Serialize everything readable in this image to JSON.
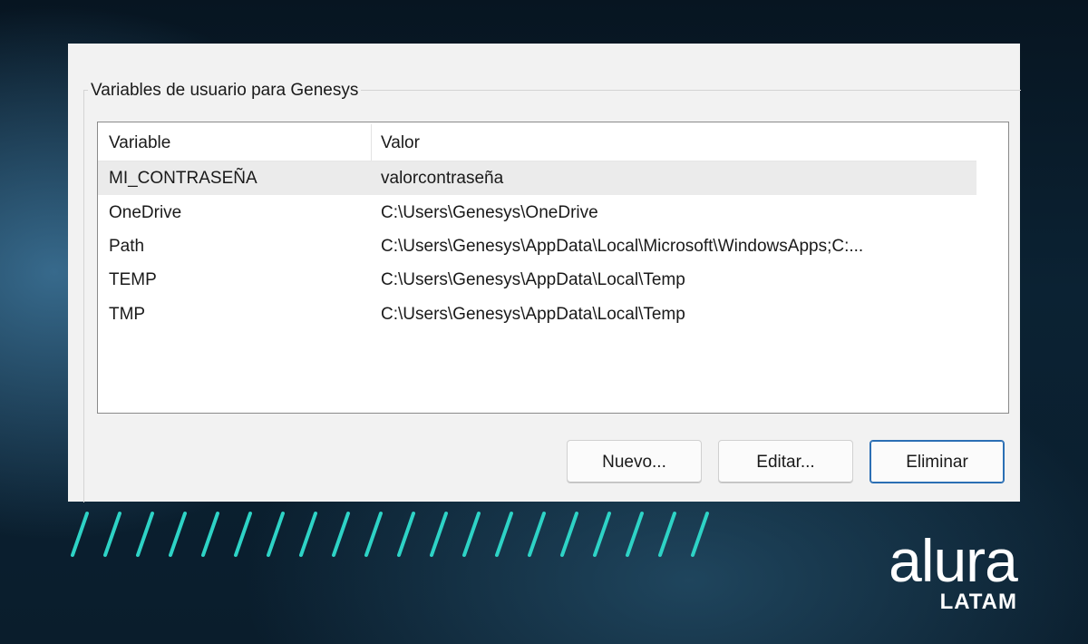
{
  "group": {
    "title": "Variables de usuario para Genesys"
  },
  "table": {
    "columns": [
      "Variable",
      "Valor"
    ],
    "rows": [
      {
        "variable": "MI_CONTRASEÑA",
        "value": "valorcontraseña",
        "selected": true
      },
      {
        "variable": "OneDrive",
        "value": "C:\\Users\\Genesys\\OneDrive"
      },
      {
        "variable": "Path",
        "value": "C:\\Users\\Genesys\\AppData\\Local\\Microsoft\\WindowsApps;C:..."
      },
      {
        "variable": "TEMP",
        "value": "C:\\Users\\Genesys\\AppData\\Local\\Temp"
      },
      {
        "variable": "TMP",
        "value": "C:\\Users\\Genesys\\AppData\\Local\\Temp"
      }
    ]
  },
  "buttons": {
    "new": "Nuevo...",
    "edit": "Editar...",
    "delete": "Eliminar"
  },
  "brand": {
    "name": "alura",
    "region": "LATAM"
  },
  "colors": {
    "accent_stripes": "#2ed3c6",
    "focus_border": "#2b6fb4",
    "selection": "#ebebeb"
  }
}
